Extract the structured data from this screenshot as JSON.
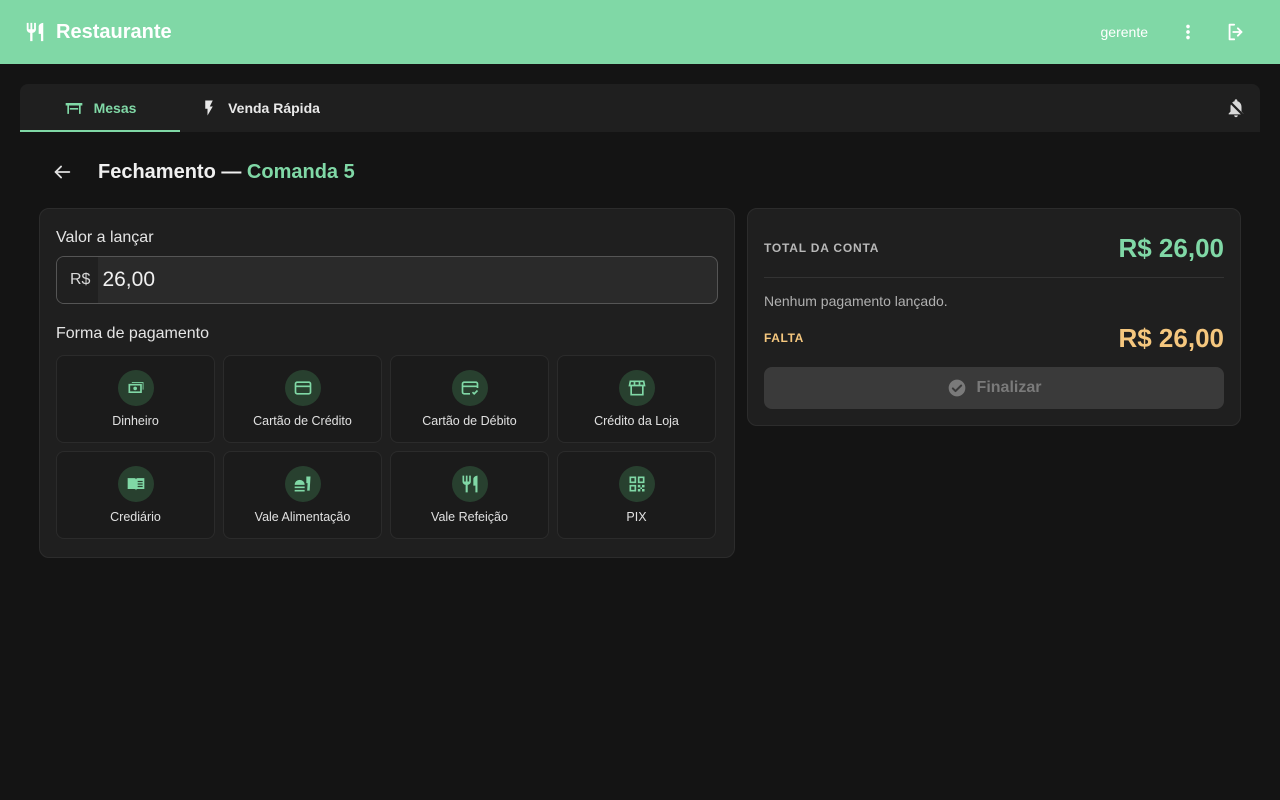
{
  "app": {
    "title": "Restaurante",
    "user": "gerente"
  },
  "tabs": [
    {
      "label": "Mesas",
      "active": true
    },
    {
      "label": "Venda Rápida",
      "active": false
    }
  ],
  "page": {
    "title_prefix": "Fechamento — ",
    "title_accent": "Comanda 5"
  },
  "launch": {
    "amount_label": "Valor a lançar",
    "currency_prefix": "R$",
    "amount_value": "26,00",
    "payment_label": "Forma de pagamento"
  },
  "payment_methods": [
    {
      "label": "Dinheiro",
      "icon": "cash-icon"
    },
    {
      "label": "Cartão de Crédito",
      "icon": "credit-card-icon"
    },
    {
      "label": "Cartão de Débito",
      "icon": "debit-card-icon"
    },
    {
      "label": "Crédito da Loja",
      "icon": "store-icon"
    },
    {
      "label": "Crediário",
      "icon": "book-icon"
    },
    {
      "label": "Vale Alimentação",
      "icon": "fastfood-icon"
    },
    {
      "label": "Vale Refeição",
      "icon": "restaurant-icon"
    },
    {
      "label": "PIX",
      "icon": "qr-code-icon"
    }
  ],
  "summary": {
    "total_label": "TOTAL DA CONTA",
    "total_value": "R$ 26,00",
    "no_payments": "Nenhum pagamento lançado.",
    "remaining_label": "FALTA",
    "remaining_value": "R$ 26,00",
    "finish_label": "Finalizar"
  },
  "colors": {
    "accent": "#80d8a6",
    "warning": "#f5c77e",
    "background": "#141414",
    "card": "#1f1f1f"
  }
}
